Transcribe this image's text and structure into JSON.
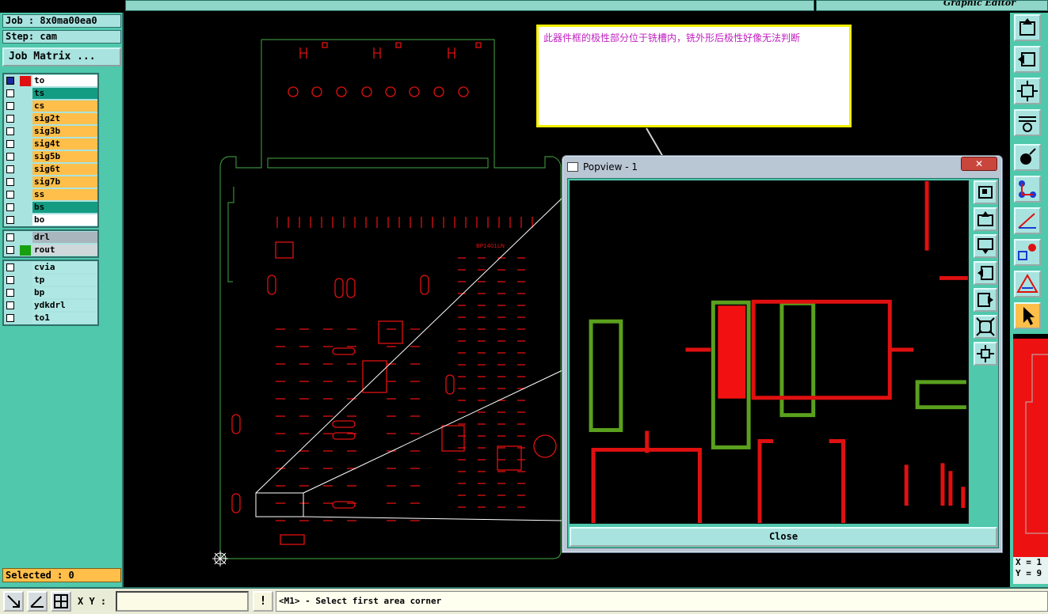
{
  "topbar": {
    "app_title": "Graphic Editor"
  },
  "job": {
    "job_label": "Job : 8x0ma00ea0",
    "step_label": "Step: cam",
    "matrix_button": "Job Matrix ..."
  },
  "layers": {
    "group1": [
      {
        "name": "to",
        "color": "#ffffff",
        "swatch": "#e01010",
        "selected": true
      },
      {
        "name": "ts",
        "color": "#149c82"
      },
      {
        "name": "cs",
        "color": "#ffbf4a"
      },
      {
        "name": "sig2t",
        "color": "#ffbf4a"
      },
      {
        "name": "sig3b",
        "color": "#ffbf4a"
      },
      {
        "name": "sig4t",
        "color": "#ffbf4a"
      },
      {
        "name": "sig5b",
        "color": "#ffbf4a"
      },
      {
        "name": "sig6t",
        "color": "#ffbf4a"
      },
      {
        "name": "sig7b",
        "color": "#ffbf4a"
      },
      {
        "name": "ss",
        "color": "#ffbf4a"
      },
      {
        "name": "bs",
        "color": "#149c82"
      },
      {
        "name": "bo",
        "color": "#ffffff"
      }
    ],
    "group2": [
      {
        "name": "drl",
        "color": "#a9b6bd"
      },
      {
        "name": "rout",
        "color": "#cfd8da",
        "swatch": "#18a010"
      }
    ],
    "group3": [
      {
        "name": "cvia",
        "color": "#aee7e4"
      },
      {
        "name": "tp",
        "color": "#aee7e4"
      },
      {
        "name": "bp",
        "color": "#aee7e4"
      },
      {
        "name": "ydkdrl",
        "color": "#aee7e4"
      },
      {
        "name": "to1",
        "color": "#aee7e4"
      }
    ]
  },
  "status": {
    "selected": "Selected : 0",
    "xy_label": "X Y :",
    "xy_value": "",
    "prompt": "<M1> - Select first area corner",
    "warn_glyph": "!"
  },
  "coords": {
    "x": "X = 1",
    "y": "Y = 9"
  },
  "annotation": {
    "text": "此器件框的极性部分位于铣槽内，铣外形后极性好像无法判断"
  },
  "popview": {
    "title": "Popview - 1",
    "close_x": "✕",
    "close_button": "Close"
  },
  "board": {
    "silk_label": "BP1401LN"
  },
  "colors": {
    "panel": "#4fc8ac",
    "pad": "#e01010",
    "outline": "#2e8a2e",
    "accent": "#ffbf4a"
  }
}
